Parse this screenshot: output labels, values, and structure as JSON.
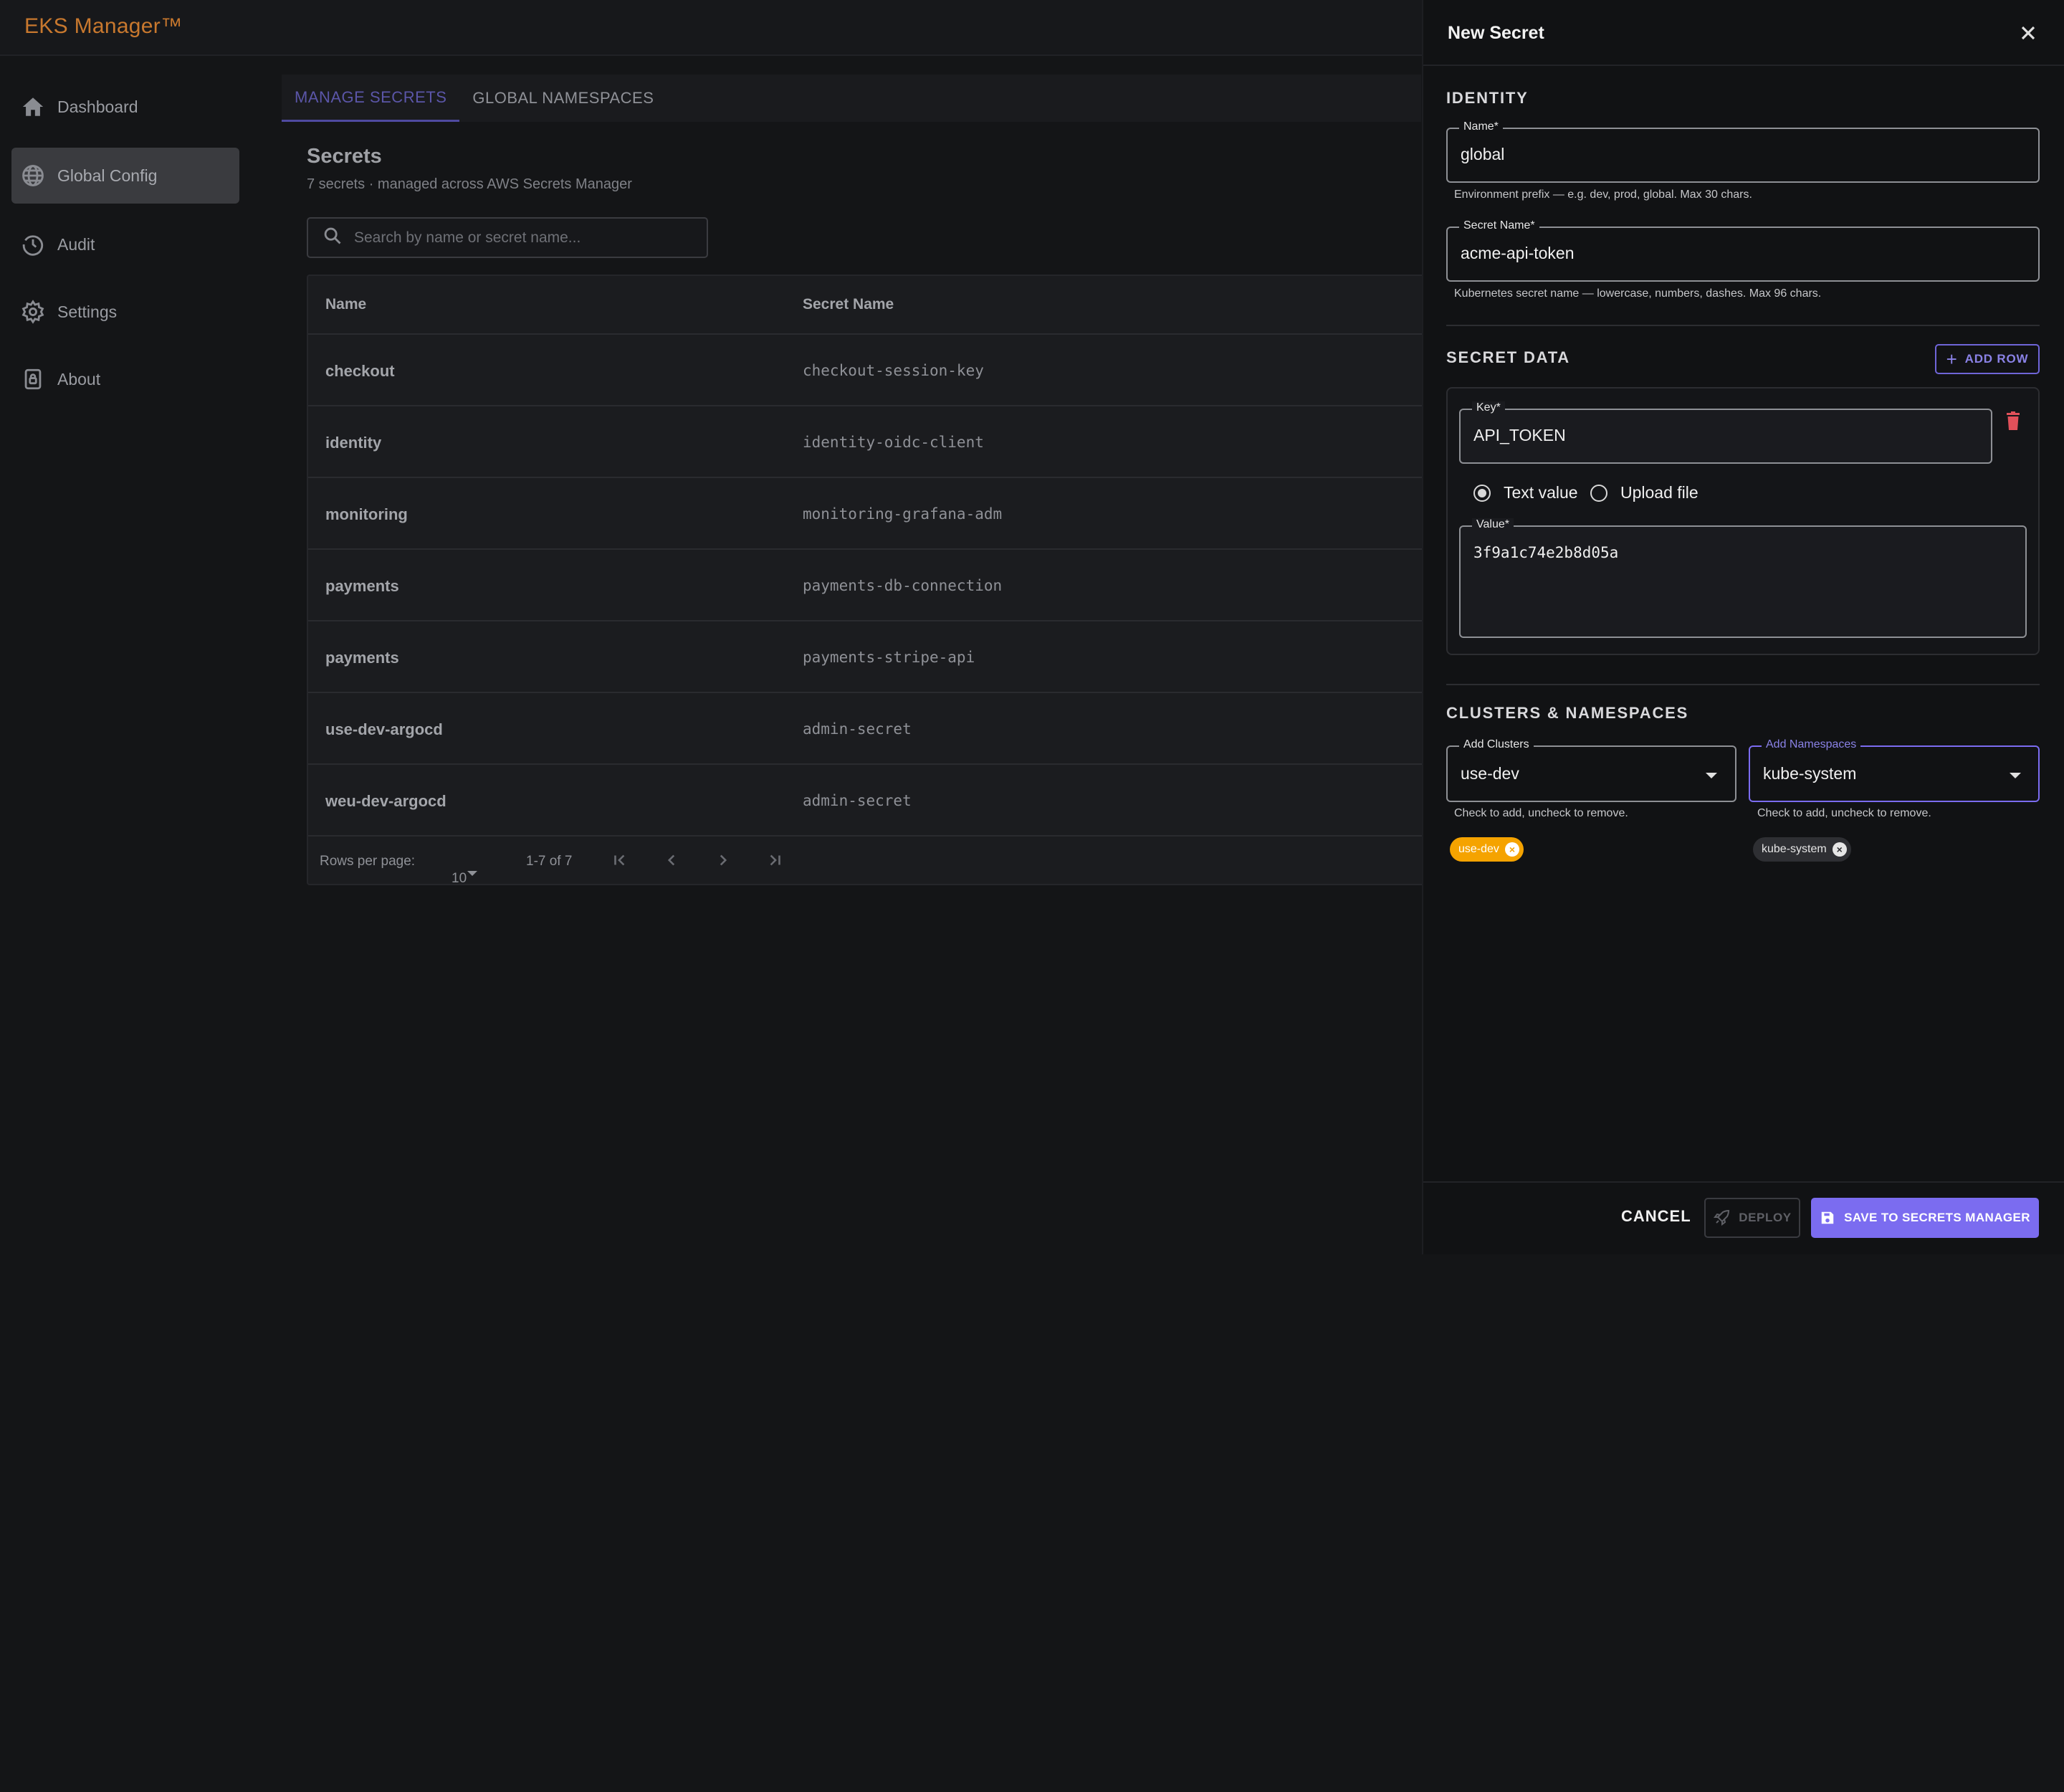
{
  "app": {
    "brand": "EKS Manager™"
  },
  "sidebar": {
    "items": [
      {
        "label": "Dashboard",
        "icon": "home-icon",
        "active": false
      },
      {
        "label": "Global Config",
        "icon": "globe-icon",
        "active": true
      },
      {
        "label": "Audit",
        "icon": "history-icon",
        "active": false
      },
      {
        "label": "Settings",
        "icon": "gear-icon",
        "active": false
      },
      {
        "label": "About",
        "icon": "lock-icon",
        "active": false
      }
    ]
  },
  "tabs": [
    {
      "label": "MANAGE SECRETS",
      "active": true
    },
    {
      "label": "GLOBAL NAMESPACES",
      "active": false
    }
  ],
  "secrets": {
    "title": "Secrets",
    "subtitle": "7 secrets · managed across AWS Secrets Manager",
    "search_placeholder": "Search by name or secret name...",
    "columns": [
      "Name",
      "Secret Name"
    ],
    "rows": [
      {
        "name": "checkout",
        "secret_name": "checkout-session-key"
      },
      {
        "name": "identity",
        "secret_name": "identity-oidc-client"
      },
      {
        "name": "monitoring",
        "secret_name": "monitoring-grafana-adm"
      },
      {
        "name": "payments",
        "secret_name": "payments-db-connection"
      },
      {
        "name": "payments",
        "secret_name": "payments-stripe-api"
      },
      {
        "name": "use-dev-argocd",
        "secret_name": "admin-secret"
      },
      {
        "name": "weu-dev-argocd",
        "secret_name": "admin-secret"
      }
    ],
    "pagination": {
      "rows_per_page_label": "Rows per page:",
      "rows_per_page": "10",
      "range": "1-7 of 7"
    }
  },
  "drawer": {
    "title": "New Secret",
    "identity": {
      "section": "IDENTITY",
      "name_label": "Name*",
      "name_value": "global",
      "name_helper": "Environment prefix — e.g. dev, prod, global. Max 30 chars.",
      "secret_name_label": "Secret Name*",
      "secret_name_value": "acme-api-token",
      "secret_name_helper": "Kubernetes secret name — lowercase, numbers, dashes. Max 96 chars."
    },
    "secret_data": {
      "section": "SECRET DATA",
      "add_row_label": "ADD ROW",
      "key_label": "Key*",
      "key_value": "API_TOKEN",
      "radio_text": "Text value",
      "radio_upload": "Upload file",
      "selected_mode": "text",
      "value_label": "Value*",
      "value_value": "3f9a1c74e2b8d05a"
    },
    "clusters": {
      "section": "CLUSTERS & NAMESPACES",
      "clusters_label": "Add Clusters",
      "clusters_value": "use-dev",
      "clusters_helper": "Check to add, uncheck to remove.",
      "cluster_chips": [
        "use-dev"
      ],
      "namespaces_label": "Add Namespaces",
      "namespaces_value": "kube-system",
      "namespaces_helper": "Check to add, uncheck to remove.",
      "namespace_chips": [
        "kube-system"
      ]
    },
    "footer": {
      "cancel": "CANCEL",
      "deploy": "DEPLOY",
      "save": "SAVE TO SECRETS MANAGER"
    }
  },
  "colors": {
    "brand": "#c8782e",
    "accent": "#7b6cf0",
    "cluster_chip": "#f5a300",
    "danger": "#e0505a"
  }
}
